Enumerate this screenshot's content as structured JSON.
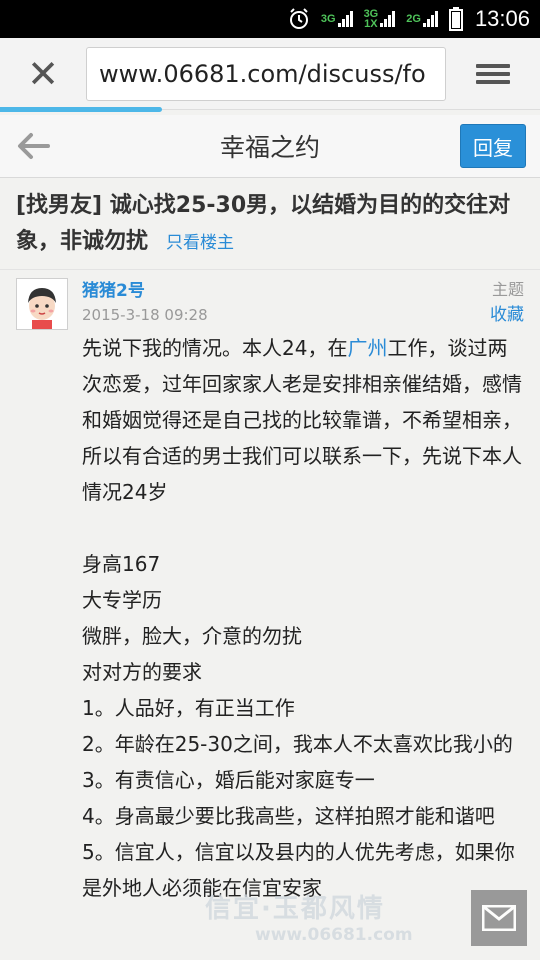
{
  "status_bar": {
    "time": "13:06",
    "net1": "3G",
    "net2_top": "3G",
    "net2_bottom": "1X",
    "net3": "2G",
    "icons": [
      "alarm-icon",
      "signal-icon",
      "battery-icon"
    ]
  },
  "browser": {
    "url": "www.06681.com/discuss/fo",
    "close_icon": "close-icon",
    "menu_icon": "menu-icon",
    "load_progress": 0.3
  },
  "nav": {
    "title": "幸福之约",
    "reply_label": "回复",
    "back_icon": "back-arrow-icon"
  },
  "thread": {
    "title": "[找男友] 诚心找25-30男，以结婚为目的的交往对象，非诚勿扰",
    "only_op_label": "只看楼主"
  },
  "post": {
    "author": "猪猪2号",
    "date": "2015-3-18 09:28",
    "subject_label": "主题",
    "favorite_label": "收藏",
    "content_intro_before": "先说下我的情况。本人24，在",
    "content_intro_link": "广州",
    "content_intro_after": "工作，谈过两次恋爱，过年回家家人老是安排相亲催结婚，感情和婚姻觉得还是自己找的比较靠谱，不希望相亲，所以有合适的男士我们可以联系一下，先说下本人情况24岁",
    "lines": [
      "身高167",
      "大专学历",
      "微胖，脸大，介意的勿扰",
      "对对方的要求",
      "1。人品好，有正当工作",
      "2。年龄在25-30之间，我本人不太喜欢比我小的",
      "3。有责信心，婚后能对家庭专一",
      "4。身高最少要比我高些，这样拍照才能和谐吧",
      "5。信宜人，信宜以及县内的人优先考虑，如果你是外地人必须能在信宜安家"
    ]
  },
  "watermark": {
    "top": "信宜·玉都风情",
    "bottom": "www.06681.com"
  },
  "colors": {
    "accent": "#2a90d8",
    "link": "#2a8bd6",
    "progress": "#4db7e8"
  }
}
